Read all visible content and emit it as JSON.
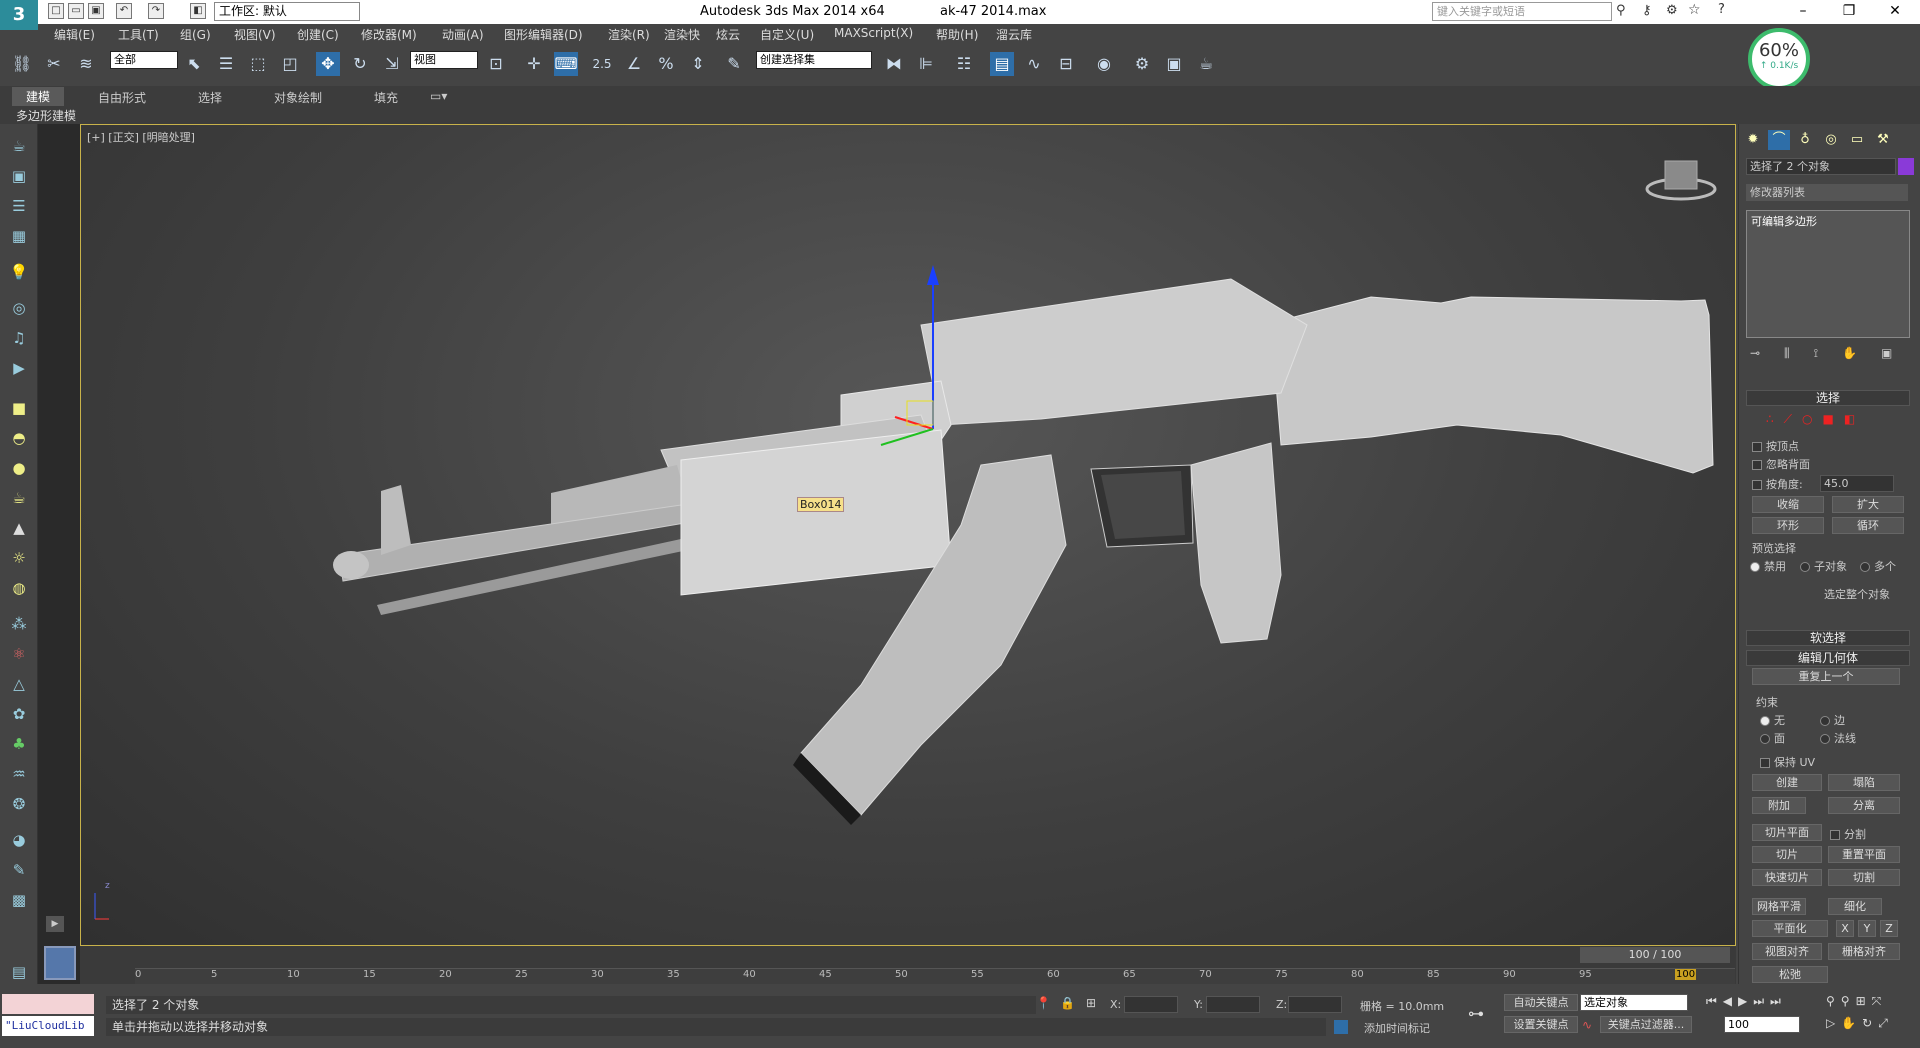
{
  "titlebar": {
    "workspace": "工作区: 默认",
    "app_title": "Autodesk 3ds Max  2014 x64",
    "file_title": "ak-47 2014.max",
    "search_placeholder": "键入关键字或短语"
  },
  "menu": [
    "编辑(E)",
    "工具(T)",
    "组(G)",
    "视图(V)",
    "创建(C)",
    "修改器(M)",
    "动画(A)",
    "图形编辑器(D)",
    "渲染(R)",
    "渲染快",
    "炫云",
    "自定义(U)",
    "MAXScript(X)",
    "帮助(H)",
    "溜云库"
  ],
  "toolbar": {
    "filter": "全部",
    "ref_coord": "视图",
    "snap_value": "2.5",
    "named_sel": "创建选择集"
  },
  "ribbon": {
    "tabs": [
      "建模",
      "自由形式",
      "选择",
      "对象绘制",
      "填充"
    ],
    "sub": "多边形建模"
  },
  "viewport": {
    "label": "[+] [正交] [明暗处理]",
    "object_label": "Box014",
    "axis_z": "z"
  },
  "perf": {
    "percent": "60%",
    "rate": "↑ 0.1K/s"
  },
  "panel": {
    "selected": "选择了 2 个对象",
    "modifier_list": "修改器列表",
    "stack_item": "可编辑多边形",
    "selection_title": "选择",
    "by_vertex": "按顶点",
    "ignore_backfacing": "忽略背面",
    "by_angle": "按角度:",
    "angle_value": "45.0",
    "shrink": "收缩",
    "grow": "扩大",
    "ring": "环形",
    "loop": "循环",
    "preview_sel": "预览选择",
    "preview_opts": [
      "禁用",
      "子对象",
      "多个"
    ],
    "whole_obj": "选定整个对象",
    "soft_sel": "软选择",
    "edit_geo": "编辑几何体",
    "repeat_last": "重复上一个",
    "constraints": "约束",
    "con_none": "无",
    "con_edge": "边",
    "con_face": "面",
    "con_normal": "法线",
    "preserve_uv": "保持 UV",
    "create": "创建",
    "collapse": "塌陷",
    "attach": "附加",
    "detach": "分离",
    "slice_plane": "切片平面",
    "split": "分割",
    "slice": "切片",
    "reset_plane": "重置平面",
    "quickslice": "快速切片",
    "cut": "切割",
    "msmooth": "网格平滑",
    "tessellate": "细化",
    "planar": "平面化",
    "x": "X",
    "y": "Y",
    "z": "Z",
    "view_align": "视图对齐",
    "grid_align": "栅格对齐",
    "relax": "松弛"
  },
  "timeline": {
    "frame": "100 / 100",
    "ticks": [
      "0",
      "5",
      "10",
      "15",
      "20",
      "25",
      "30",
      "35",
      "40",
      "45",
      "50",
      "55",
      "60",
      "65",
      "70",
      "75",
      "80",
      "85",
      "90",
      "95",
      "100"
    ]
  },
  "status": {
    "script": "\"LiuCloudLib",
    "selected": "选择了 2 个对象",
    "hint": "单击并拖动以选择并移动对象",
    "x_label": "X:",
    "y_label": "Y:",
    "z_label": "Z:",
    "grid": "栅格 = 10.0mm",
    "autokey": "自动关键点",
    "setkey": "设置关键点",
    "sel_object": "选定对象",
    "add_time_tag": "添加时间标记",
    "key_filters": "关键点过滤器...",
    "frame_field": "100"
  }
}
